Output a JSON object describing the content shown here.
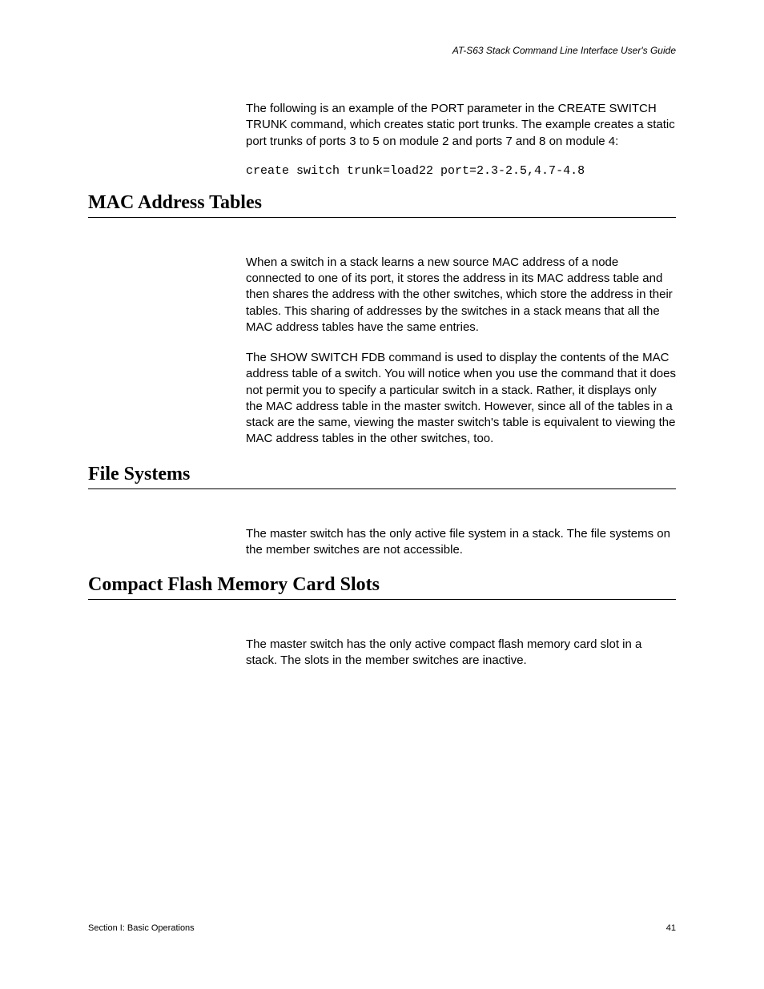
{
  "header": {
    "running_title": "AT-S63 Stack Command Line Interface User's Guide"
  },
  "intro": {
    "para1": "The following is an example of the PORT parameter in the CREATE SWITCH TRUNK command, which creates static port trunks. The example creates a static port trunks of ports 3 to 5 on module 2 and ports 7 and 8 on module 4:",
    "code": "create switch trunk=load22 port=2.3-2.5,4.7-4.8"
  },
  "sections": {
    "mac": {
      "heading": "MAC Address Tables",
      "para1": "When a switch in a stack learns a new source MAC address of a node connected to one of its port, it stores the address in its MAC address table and then shares the address with the other switches, which store the address in their tables. This sharing of addresses by the switches in a stack means that all the MAC address tables have the same entries.",
      "para2": "The SHOW SWITCH FDB command is used to display the contents of the MAC address table of a switch. You will notice when you use the command that it does not permit you to specify a particular switch in a stack. Rather, it displays only the MAC address table in the master switch. However, since all of the tables in a stack are the same, viewing the master switch's table is equivalent to viewing the MAC address tables in the other switches, too."
    },
    "fs": {
      "heading": "File Systems",
      "para1": "The master switch has the only active file system in a stack. The file systems on the member switches are not accessible."
    },
    "cf": {
      "heading": "Compact Flash Memory Card Slots",
      "para1": "The master switch has the only active compact flash memory card slot in a stack. The slots in the member switches are inactive."
    }
  },
  "footer": {
    "left": "Section I: Basic Operations",
    "right": "41"
  }
}
